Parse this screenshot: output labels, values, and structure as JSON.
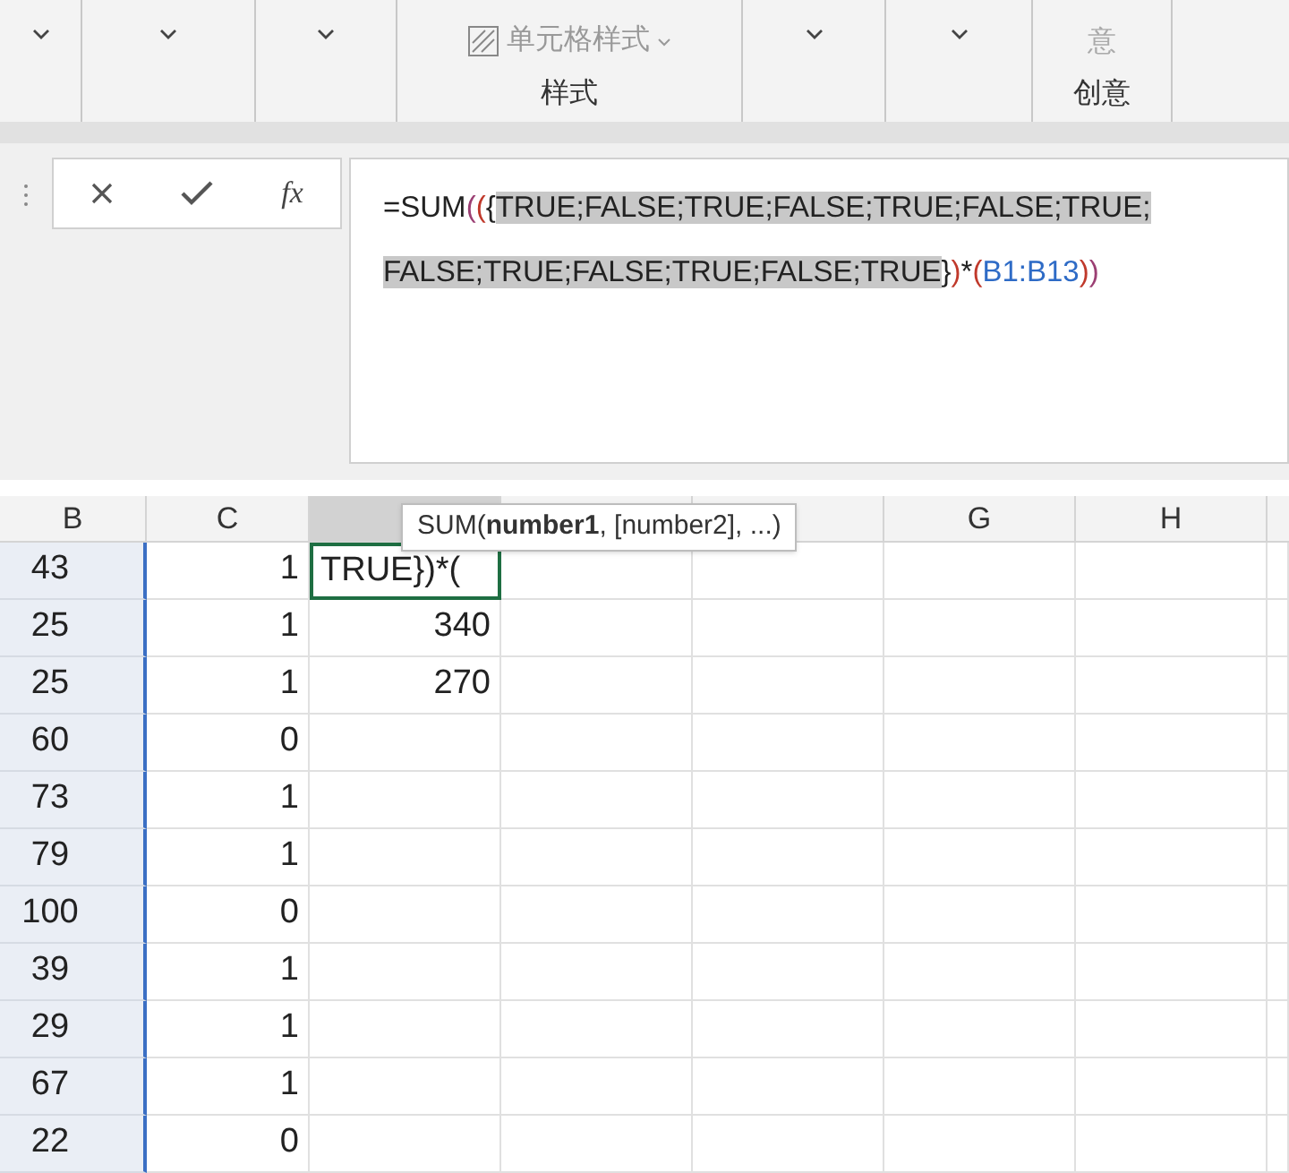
{
  "ribbon": {
    "groups": [
      {
        "kind": "dropdown"
      },
      {
        "kind": "dropdown"
      },
      {
        "kind": "dropdown"
      },
      {
        "kind": "style",
        "button": "单元格样式",
        "label": "样式"
      },
      {
        "kind": "dropdown"
      },
      {
        "kind": "dropdown"
      },
      {
        "kind": "creative",
        "button": "意",
        "label": "创意"
      }
    ]
  },
  "formula_bar": {
    "fx": "fx",
    "formula": [
      {
        "text": "=SUM",
        "color": "#222222",
        "highlighted": false
      },
      {
        "text": "(",
        "color": "#9b3f73",
        "highlighted": false
      },
      {
        "text": "(",
        "color": "#c0392b",
        "highlighted": false
      },
      {
        "text": "{",
        "color": "#222222",
        "highlighted": false
      },
      {
        "text": "TRUE;FALSE;TRUE;FALSE;TRUE;FALSE;TRUE; FALSE;TRUE;FALSE;TRUE;FALSE;TRUE",
        "color": "#222222",
        "highlighted": true
      },
      {
        "text": "}",
        "color": "#222222",
        "highlighted": false
      },
      {
        "text": ")",
        "color": "#c0392b",
        "highlighted": false
      },
      {
        "text": "*",
        "color": "#222222",
        "highlighted": false
      },
      {
        "text": "(",
        "color": "#c0392b",
        "highlighted": false
      },
      {
        "text": "B1:B13",
        "color": "#2e6bc6",
        "highlighted": false
      },
      {
        "text": ")",
        "color": "#c0392b",
        "highlighted": false
      },
      {
        "text": ")",
        "color": "#9b3f73",
        "highlighted": false
      }
    ]
  },
  "grid": {
    "columns": [
      {
        "label": "B",
        "selected": false
      },
      {
        "label": "C",
        "selected": false
      },
      {
        "selected": true
      },
      {
        "selected": false
      },
      {
        "selected": false
      },
      {
        "label": "G",
        "selected": false
      },
      {
        "label": "H",
        "selected": false
      }
    ],
    "rows": [
      {
        "cells": [
          "43",
          "1",
          "TRUE})*("
        ]
      },
      {
        "cells": [
          "25",
          "1",
          "340"
        ]
      },
      {
        "cells": [
          "25",
          "1",
          "270"
        ]
      },
      {
        "cells": [
          "60",
          "0",
          ""
        ]
      },
      {
        "cells": [
          "73",
          "1",
          ""
        ]
      },
      {
        "cells": [
          "79",
          "1",
          ""
        ]
      },
      {
        "cells": [
          "100",
          "0",
          ""
        ]
      },
      {
        "cells": [
          "39",
          "1",
          ""
        ]
      },
      {
        "cells": [
          "29",
          "1",
          ""
        ]
      },
      {
        "cells": [
          "67",
          "1",
          ""
        ]
      },
      {
        "cells": [
          "22",
          "0",
          ""
        ]
      }
    ]
  },
  "tooltip": "SUM(**number1**, [number2], ...)"
}
